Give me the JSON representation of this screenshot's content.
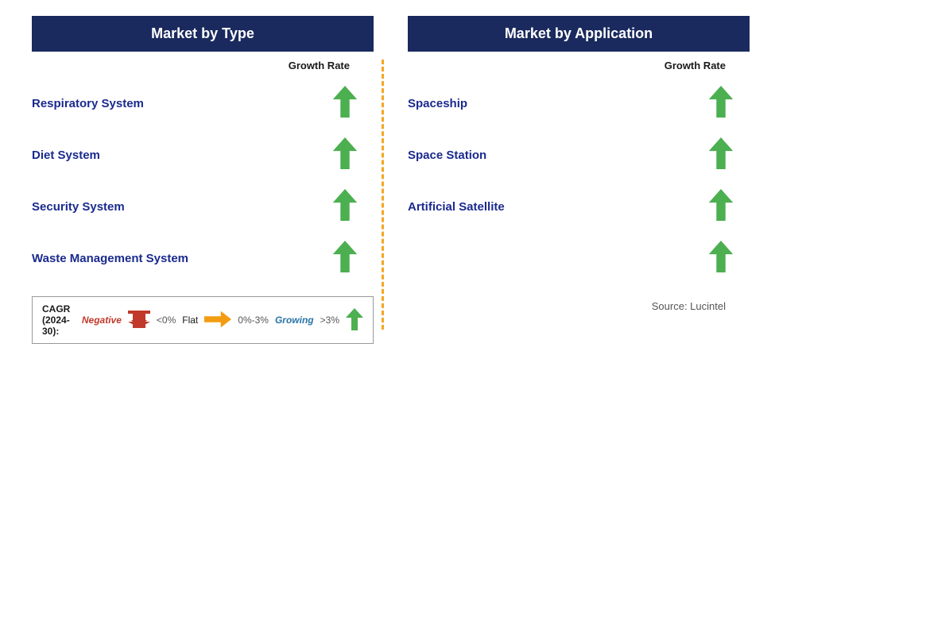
{
  "leftPanel": {
    "title": "Market by Type",
    "growthRateLabel": "Growth Rate",
    "rows": [
      {
        "label": "Respiratory System"
      },
      {
        "label": "Diet System"
      },
      {
        "label": "Security System"
      },
      {
        "label": "Waste Management System"
      }
    ],
    "legend": {
      "cagrLabel": "CAGR\n(2024-30):",
      "negativeLabel": "Negative",
      "negativeValue": "<0%",
      "flatLabel": "Flat",
      "flatValue": "0%-3%",
      "growingLabel": "Growing",
      "growingValue": ">3%"
    }
  },
  "rightPanel": {
    "title": "Market by Application",
    "growthRateLabel": "Growth Rate",
    "rows": [
      {
        "label": "Spaceship"
      },
      {
        "label": "Space Station"
      },
      {
        "label": "Artificial Satellite"
      },
      {
        "label": ""
      }
    ],
    "sourceText": "Source: Lucintel"
  }
}
